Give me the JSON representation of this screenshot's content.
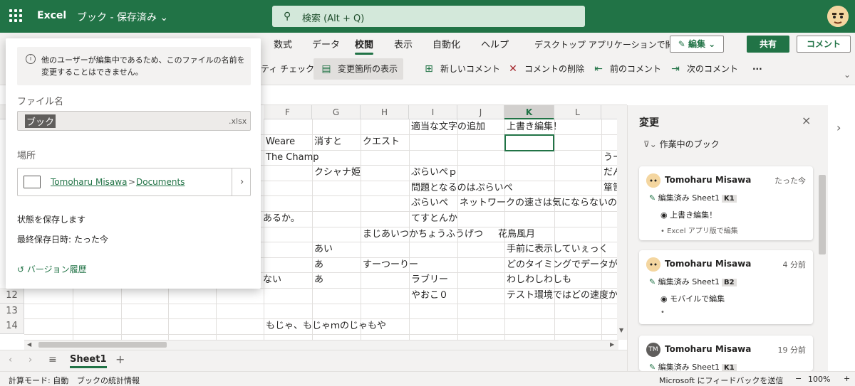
{
  "header": {
    "app_name": "Excel",
    "doc_title": "ブック - 保存済み ⌄",
    "search_placeholder": "検索 (Alt + Q)"
  },
  "ribbon": {
    "tabs": [
      "数式",
      "データ",
      "校閲",
      "表示",
      "自動化",
      "ヘルプ"
    ],
    "active_tab": "校閲",
    "desktop_open": "デスクトップ アプリケーションで開く",
    "edit_label": "✎ 編集 ⌄",
    "share_label": "共有",
    "comment_label": "コメント",
    "partial_check": "ティ チェック",
    "show_changes": "変更箇所の表示",
    "new_comment": "新しいコメント",
    "delete_comment": "コメントの削除",
    "prev_comment": "前のコメント",
    "next_comment": "次のコメント",
    "more": "···"
  },
  "grid": {
    "columns": [
      "F",
      "G",
      "H",
      "I",
      "J",
      "K",
      "L"
    ],
    "selected_column": "K",
    "rows": [
      "12",
      "13",
      "14"
    ],
    "cells": [
      {
        "id": "c1",
        "text": "適当な文字の追加"
      },
      {
        "id": "c2",
        "text": "上書き編集！"
      },
      {
        "id": "c3",
        "text": "Weare"
      },
      {
        "id": "c4",
        "text": "消すと"
      },
      {
        "id": "c5",
        "text": "クエスト"
      },
      {
        "id": "c6",
        "text": "The Champ"
      },
      {
        "id": "c7",
        "text": "うー"
      },
      {
        "id": "c8",
        "text": "クシャナ姫"
      },
      {
        "id": "c9",
        "text": "ぷらいぺｐ"
      },
      {
        "id": "c10",
        "text": "だん"
      },
      {
        "id": "c11",
        "text": "問題となるのはぷらいぺ"
      },
      {
        "id": "c12",
        "text": "箪笥"
      },
      {
        "id": "c13",
        "text": "ぷらいぺ"
      },
      {
        "id": "c14",
        "text": "ネットワークの速さは気にならないの"
      },
      {
        "id": "c15",
        "text": "あるか。"
      },
      {
        "id": "c16",
        "text": "てすとんか"
      },
      {
        "id": "c17",
        "text": "まじあいつかちょうふうげつ"
      },
      {
        "id": "c18",
        "text": "花鳥風月"
      },
      {
        "id": "c19",
        "text": "あい"
      },
      {
        "id": "c20",
        "text": "手前に表示していぇっく"
      },
      {
        "id": "c21",
        "text": "あ"
      },
      {
        "id": "c22",
        "text": "すーつーりー"
      },
      {
        "id": "c23",
        "text": "どのタイミングでデータが"
      },
      {
        "id": "c24",
        "text": "ない"
      },
      {
        "id": "c25",
        "text": "あ"
      },
      {
        "id": "c26",
        "text": "ラブリー"
      },
      {
        "id": "c27",
        "text": "わしわしわしも"
      },
      {
        "id": "c28",
        "text": "やおこ０"
      },
      {
        "id": "c29",
        "text": "テスト環境ではどの速度か"
      },
      {
        "id": "c30",
        "text": "もじゃ、もじゃｍのじゃもや"
      }
    ]
  },
  "sheet_tabs": {
    "active": "Sheet1",
    "add": "+"
  },
  "status": {
    "calc_mode": "計算モード: 自動",
    "book_stats": "ブックの統計情報",
    "feedback": "Microsoft にフィードバックを送信",
    "zoom": "100%",
    "zoom_minus": "−",
    "zoom_plus": "+"
  },
  "changes_pane": {
    "title": "変更",
    "close": "×",
    "filter": "作業中のブック",
    "cards": [
      {
        "user": "Tomoharu Misawa",
        "time": "たった今",
        "action": "編集済み Sheet1",
        "cell": "K1",
        "line1": "上書き編集！",
        "line2": "Excel アプリ版で編集"
      },
      {
        "user": "Tomoharu Misawa",
        "time": "4 分前",
        "action": "編集済み Sheet1",
        "cell": "B2",
        "line1": "モバイルで編集",
        "line2": ""
      },
      {
        "user": "Tomoharu Misawa",
        "time": "19 分前",
        "action": "編集済み Sheet1",
        "cell": "K1",
        "initials": "TM"
      }
    ]
  },
  "file_popup": {
    "info": "他のユーザーが編集中であるため、このファイルの名前を変更することはできません。",
    "filename_label": "ファイル名",
    "filename": "ブック",
    "ext": ".xlsx",
    "location_label": "場所",
    "loc_user": "Tomoharu Misawa",
    "loc_sep": ">",
    "loc_folder": "Documents",
    "save_state": "状態を保存します",
    "last_saved": "最終保存日時: たった今",
    "version_history": "バージョン履歴"
  }
}
